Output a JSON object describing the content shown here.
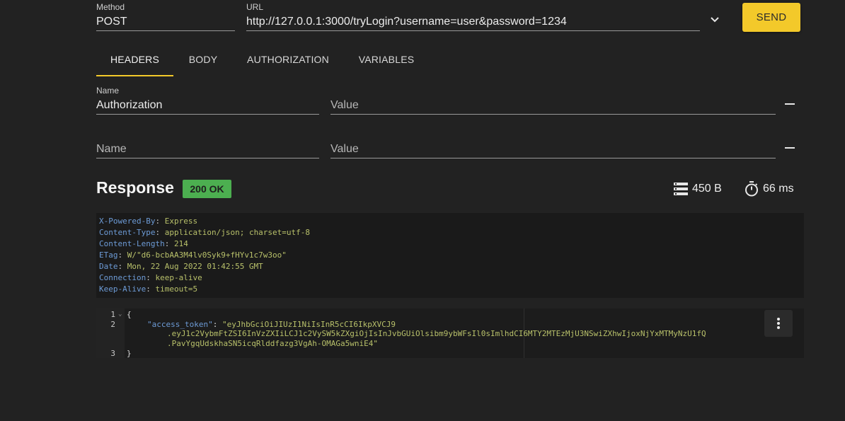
{
  "request": {
    "method_label": "Method",
    "method_value": "POST",
    "url_label": "URL",
    "url_value": "http://127.0.0.1:3000/tryLogin?username=user&password=1234",
    "send_label": "SEND"
  },
  "tabs": [
    {
      "label": "HEADERS",
      "active": true
    },
    {
      "label": "BODY",
      "active": false
    },
    {
      "label": "AUTHORIZATION",
      "active": false
    },
    {
      "label": "VARIABLES",
      "active": false
    }
  ],
  "header_rows": [
    {
      "name_label": "Name",
      "name_value": "Authorization",
      "name_placeholder": "Name",
      "value_value": "",
      "value_placeholder": "Value"
    },
    {
      "name_label": "",
      "name_value": "",
      "name_placeholder": "Name",
      "value_value": "",
      "value_placeholder": "Value"
    }
  ],
  "response": {
    "title": "Response",
    "status": "200 OK",
    "status_color": "#4caf50",
    "size": "450 B",
    "size_icon": "storage-icon",
    "time": "66 ms",
    "time_icon": "timer-icon",
    "headers": [
      {
        "key": "X-Powered-By",
        "value": "Express"
      },
      {
        "key": "Content-Type",
        "value": "application/json; charset=utf-8"
      },
      {
        "key": "Content-Length",
        "value": "214"
      },
      {
        "key": "ETag",
        "value": "W/\"d6-bcbAA3M4lv0Syk9+fHYv1c7w3oo\""
      },
      {
        "key": "Date",
        "value": "Mon, 22 Aug 2022 01:42:55 GMT"
      },
      {
        "key": "Connection",
        "value": "keep-alive"
      },
      {
        "key": "Keep-Alive",
        "value": "timeout=5"
      }
    ],
    "body": {
      "line_numbers": [
        "1",
        "2",
        "3"
      ],
      "open_brace": "{",
      "close_brace": "}",
      "key": "\"access_token\"",
      "token_line1": "\"eyJhbGciOiJIUzI1NiIsInR5cCI6IkpXVCJ9",
      "token_line2": ".eyJ1c2VybmFtZSI6InVzZXIiLCJ1c2VySW5kZXgiOjIsInJvbGUiOlsibm9ybWFsIl0sImlhdCI6MTY2MTEzMjU3NSwiZXhwIjoxNjYxMTMyNzU1fQ",
      "token_line3": ".PavYgqUdskhaSN5icqRlddfazg3VgAh-OMAGa5wniE4\""
    }
  },
  "accent_color": "#f3c92a"
}
